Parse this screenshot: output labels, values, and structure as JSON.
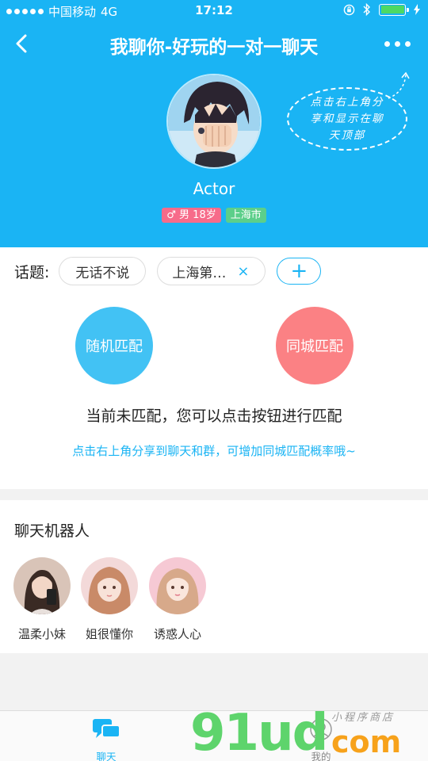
{
  "status_bar": {
    "carrier": "中国移动",
    "network": "4G",
    "time": "17:12",
    "battery_level": 1.0
  },
  "navbar": {
    "title": "我聊你-好玩的一对一聊天"
  },
  "profile": {
    "name": "Actor",
    "gender_age": "男 18岁",
    "city": "上海市"
  },
  "share_hint": {
    "line1": "点击右上角分",
    "line2": "享和显示在聊",
    "line3": "天顶部"
  },
  "topics": {
    "label": "话题:",
    "chips": [
      "无话不说",
      "上海第…"
    ],
    "add_symbol": "+",
    "remove_symbol": "×"
  },
  "match": {
    "random_label": "随机匹配",
    "city_label": "同城匹配",
    "status": "当前未匹配，您可以点击按钮进行匹配",
    "tip": "点击右上角分享到聊天和群，可增加同城匹配概率哦~"
  },
  "robots": {
    "title": "聊天机器人",
    "items": [
      {
        "name": "温柔小妹"
      },
      {
        "name": "姐很懂你"
      },
      {
        "name": "诱惑人心"
      }
    ]
  },
  "tabbar": {
    "chat_label": "聊天",
    "mine_label": "我的"
  },
  "watermark": {
    "main": "91ud",
    "domain": "com",
    "subtitle": "小程序商店"
  },
  "colors": {
    "primary": "#1ab4f4",
    "random_match": "#42c2f4",
    "city_match": "#fb8184",
    "gender_tag": "#f76b8a",
    "city_tag": "#5ccf8a"
  }
}
